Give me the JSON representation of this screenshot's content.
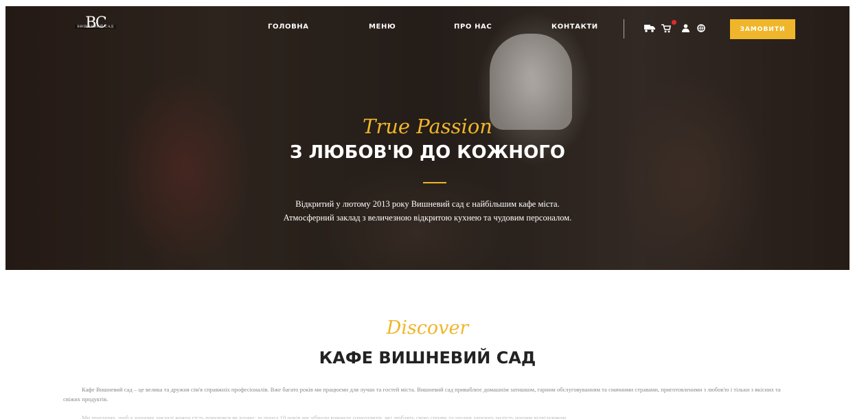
{
  "brand": {
    "monogram": "BC",
    "name": "ВИШНЕВИЙ САД"
  },
  "nav": {
    "items": [
      {
        "label": "ГОЛОВНА"
      },
      {
        "label": "МЕНЮ"
      },
      {
        "label": "ПРО НАС"
      },
      {
        "label": "КОНТАКТИ"
      }
    ],
    "icons": [
      "delivery-truck-icon",
      "cart-icon",
      "user-icon",
      "globe-icon"
    ],
    "order_button": "ЗАМОВИТИ"
  },
  "hero": {
    "script": "True Passion",
    "title": "З ЛЮБОВ'Ю ДО КОЖНОГО",
    "line1": "Відкритий у лютому 2013 року Вишневий сад є найбільшим кафе міста.",
    "line2": "Атмосферний заклад з величезною відкритою кухнею та чудовим персоналом."
  },
  "about": {
    "script": "Discover",
    "title": "КАФЕ ВИШНЕВИЙ САД",
    "paragraph1": "Кафе Вишневий сад – це велика та дружня сім'я справжніх професіоналів. Вже багато років ми працюємо для лучан та гостей міста. Вишневий сад приваблює домашнім затишком, гарним обслуговуванням та смачними стравами, приготовленими з любов'ю і тільки з якісних та свіжих продуктів.",
    "paragraph2": "Ми прагнемо, щоб у нашому закладі кожен гість почувався як вдома: за понад 10 років ми зібрали команду однодумців, які люблять свою справу та щодня дарують радість нашим відвідувачам."
  },
  "colors": {
    "accent": "#f0b62b",
    "badge": "#e02c2c",
    "heading": "#222222",
    "body_text": "#888888"
  }
}
